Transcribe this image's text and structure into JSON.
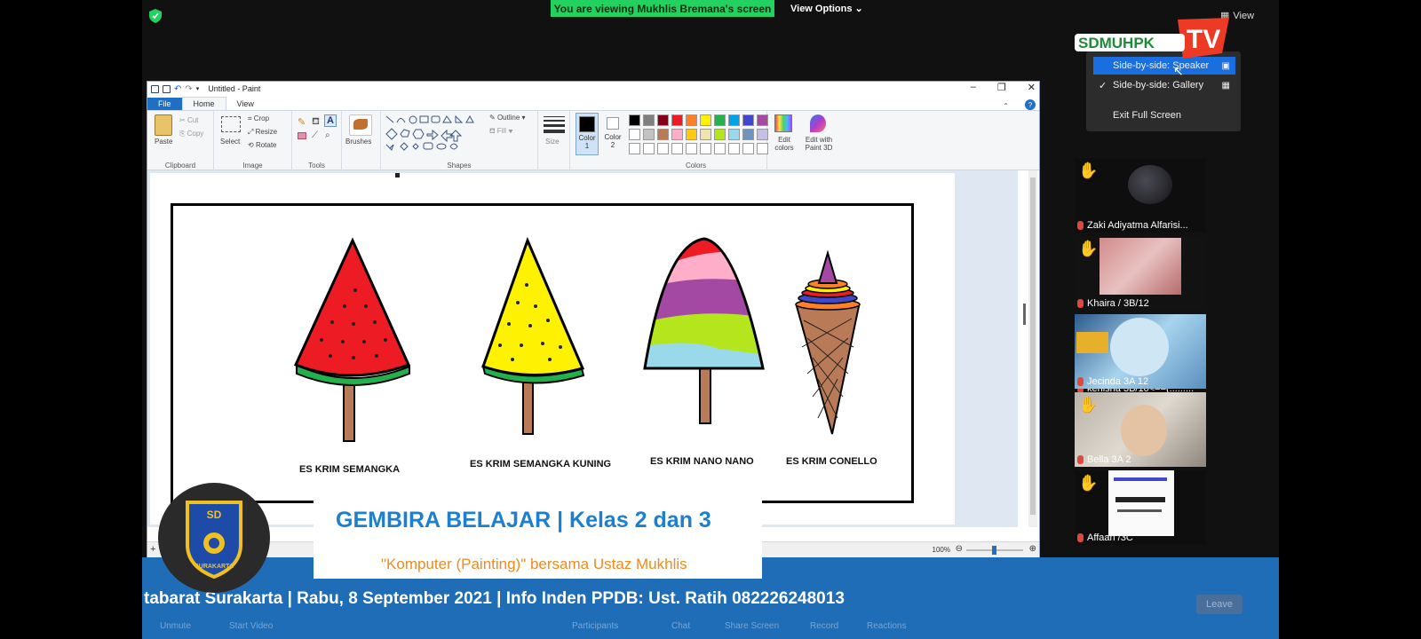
{
  "meeting": {
    "banner": "You are viewing Mukhlis Bremana's screen",
    "view_options": "View Options",
    "view_label": "View"
  },
  "paint": {
    "title": "Untitled - Paint",
    "tabs": [
      "File",
      "Home",
      "View"
    ],
    "clipboard": {
      "paste": "Paste",
      "cut": "Cut",
      "copy": "Copy",
      "label": "Clipboard"
    },
    "image": {
      "select": "Select",
      "crop": "Crop",
      "resize": "Resize",
      "rotate": "Rotate",
      "label": "Image"
    },
    "tools": {
      "label": "Tools"
    },
    "brushes": "Brushes",
    "shapes": {
      "outline": "Outline",
      "fill": "Fill",
      "label": "Shapes"
    },
    "size": "Size",
    "color1": [
      "Color",
      "1"
    ],
    "color2": [
      "Color",
      "2"
    ],
    "colors_label": "Colors",
    "edit_colors": [
      "Edit",
      "colors"
    ],
    "edit3d": [
      "Edit with",
      "Paint 3D"
    ],
    "palette_row1": [
      "#000000",
      "#7f7f7f",
      "#880015",
      "#ed1c24",
      "#ff7f27",
      "#fff200",
      "#22b14c",
      "#00a2e8",
      "#3f48cc",
      "#a349a4"
    ],
    "palette_row2": [
      "#ffffff",
      "#c3c3c3",
      "#b97a57",
      "#ffaec9",
      "#ffc90e",
      "#efe4b0",
      "#b5e61d",
      "#99d9ea",
      "#7092be",
      "#c8bfe7"
    ],
    "zoom": "100%",
    "labels": [
      "ES KRIM SEMANGKA",
      "ES KRIM SEMANGKA KUNING",
      "ES KRIM NANO NANO",
      "ES KRIM CONELLO"
    ]
  },
  "menu": {
    "items": [
      "Side-by-side: Speaker",
      "Side-by-side: Gallery",
      "Exit Full Screen"
    ]
  },
  "channel_logo": "SDMUHPKTV",
  "participants": [
    {
      "name": "kenisha 3B/10<==(:::::...."
    },
    {
      "name": "Zaki Adiyatma Alfarisi..."
    },
    {
      "name": "Khaira / 3B/12"
    },
    {
      "name": "Jecinda 3A 12"
    },
    {
      "name": "Bella 3A 2"
    },
    {
      "name": "Affaan /3C"
    }
  ],
  "overlay": {
    "school_badge": [
      "SD",
      "SURAKARTA"
    ],
    "card_title": "GEMBIRA BELAJAR | Kelas 2 dan 3",
    "card_subtitle": "\"Komputer (Painting)\" bersama Ustaz Mukhlis",
    "ticker": "tabarat Surakarta | Rabu, 8 September 2021 | Info Inden PPDB: Ust. Ratih 082226248013"
  },
  "zoom_toolbar": [
    "Unmute",
    "Start Video",
    "Participants",
    "Chat",
    "Share Screen",
    "Record",
    "Reactions"
  ],
  "leave": "Leave"
}
